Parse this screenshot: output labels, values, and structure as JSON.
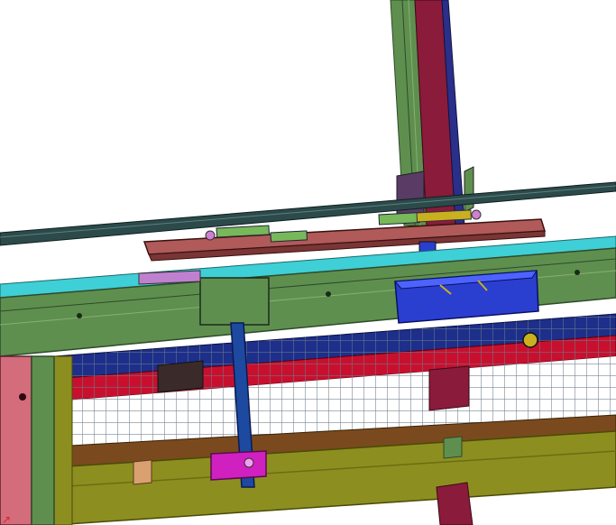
{
  "viewport": {
    "background": "#ffffff",
    "axis_indicator_glyph": "↗"
  },
  "palette": {
    "frame_green": "#5f8f4f",
    "frame_green_dark": "#3f6a35",
    "bright_green": "#76b85a",
    "olive": "#8c8f1f",
    "olive_dark": "#6b6d14",
    "brown": "#7a4a1e",
    "maroon": "#8b1b3b",
    "red": "#c8102e",
    "navy": "#1d2f8a",
    "blue": "#2a3fd0",
    "cyan": "#3fcfd6",
    "pink_panel": "#d36c7b",
    "plate": "#b05a5a",
    "magenta": "#d020c0",
    "rail": "#2c4a4a",
    "mesh_line": "#6a7a8a"
  }
}
